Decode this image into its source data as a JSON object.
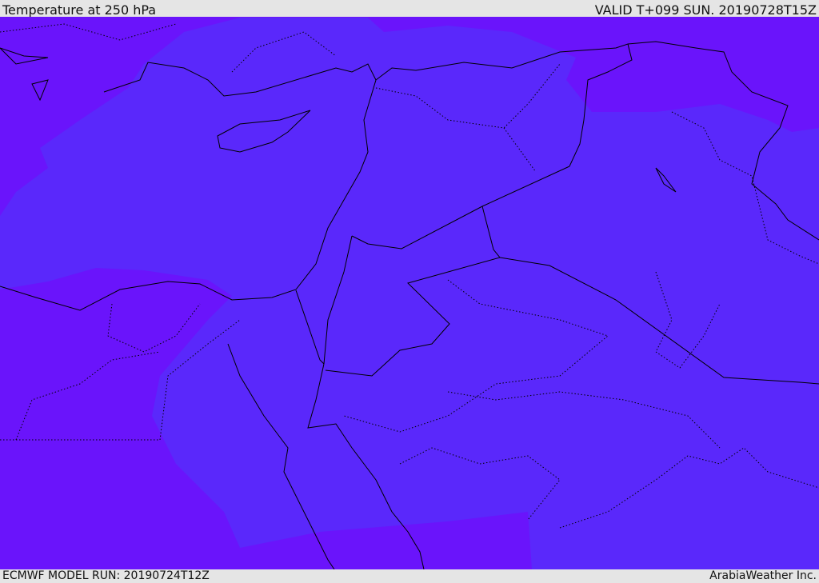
{
  "header": {
    "title": "Temperature at 250 hPa",
    "valid": "VALID T+099 SUN. 20190728T15Z"
  },
  "footer": {
    "model_run": "ECMWF MODEL RUN: 20190724T12Z",
    "credit": "ArabiaWeather Inc."
  },
  "colors": {
    "background": "#e5e5e5",
    "temp_dark": "#6a14fb",
    "temp_light": "#5a28fb",
    "lines": "#000000"
  }
}
